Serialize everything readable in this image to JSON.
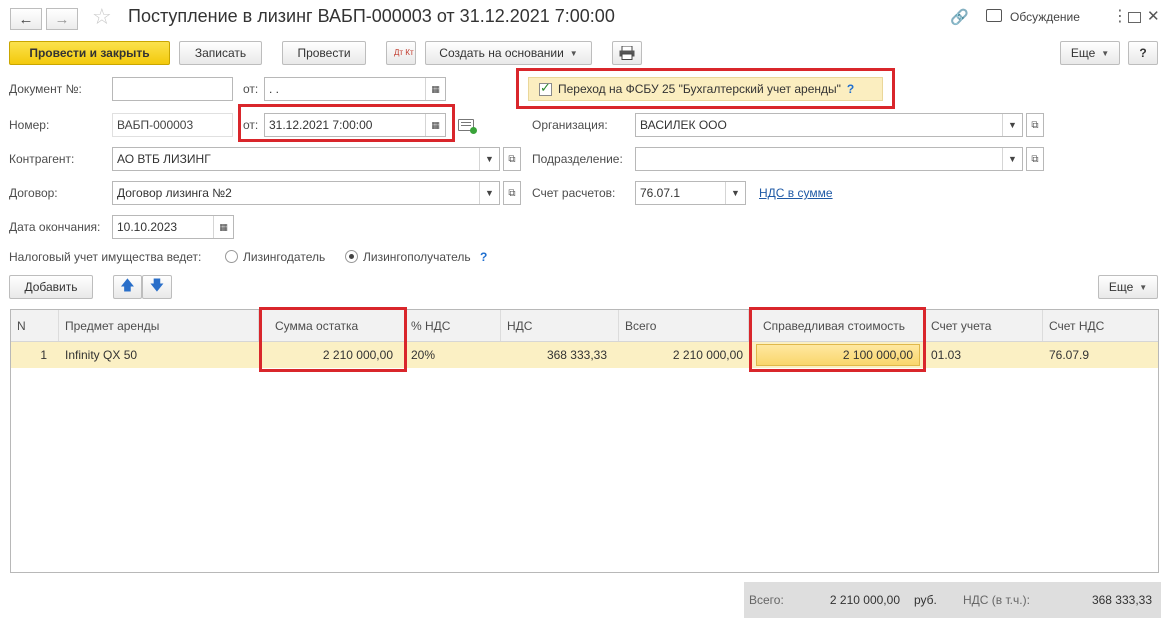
{
  "window": {
    "title": "Поступление в лизинг ВАБП-000003 от 31.12.2021 7:00:00",
    "discussion_label": "Обсуждение"
  },
  "toolbar": {
    "post_close": "Провести и закрыть",
    "save": "Записать",
    "post": "Провести",
    "dt_kt": "Дт Кт",
    "create_based": "Создать на основании",
    "more": "Еще",
    "help": "?"
  },
  "form": {
    "doc_no_label": "Документ №:",
    "doc_no_value": "",
    "doc_from_label": "от:",
    "doc_from_value": " .  .",
    "fsbu_label": "Переход на ФСБУ 25 \"Бухгалтерский учет аренды\"",
    "fsbu_checked": true,
    "number_label": "Номер:",
    "number_value": "ВАБП-000003",
    "date_label": "от:",
    "date_value": "31.12.2021  7:00:00",
    "org_label": "Организация:",
    "org_value": "ВАСИЛЕК ООО",
    "contractor_label": "Контрагент:",
    "contractor_value": "АО ВТБ ЛИЗИНГ",
    "division_label": "Подразделение:",
    "division_value": "",
    "contract_label": "Договор:",
    "contract_value": "Договор лизинга №2",
    "account_label": "Счет расчетов:",
    "account_value": "76.07.1",
    "vat_link": "НДС в сумме",
    "end_date_label": "Дата окончания:",
    "end_date_value": "10.10.2023",
    "tax_label": "Налоговый учет имущества ведет:",
    "tax_option_1": "Лизингодатель",
    "tax_option_2": "Лизингополучатель",
    "tax_selected": "Лизингополучатель"
  },
  "table_toolbar": {
    "add": "Добавить",
    "more": "Еще"
  },
  "table": {
    "columns": [
      "N",
      "Предмет аренды",
      "Сумма остатка",
      "% НДС",
      "НДС",
      "Всего",
      "Справедливая стоимость",
      "Счет учета",
      "Счет НДС"
    ],
    "rows": [
      [
        "1",
        "Infinity QX 50",
        "2 210 000,00",
        "20%",
        "368 333,33",
        "2 210 000,00",
        "2 100 000,00",
        "01.03",
        "76.07.9"
      ]
    ]
  },
  "footer": {
    "total_label": "Всего:",
    "total_value": "2 210 000,00",
    "currency": "руб.",
    "vat_label": "НДС (в т.ч.):",
    "vat_value": "368 333,33"
  }
}
